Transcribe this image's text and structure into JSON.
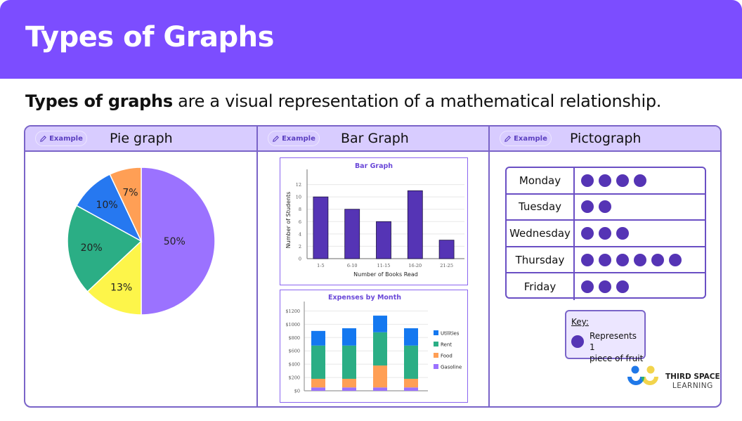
{
  "header": {
    "title": "Types of Graphs"
  },
  "intro": {
    "bold": "Types of graphs",
    "rest": " are a visual representation of a mathematical relationship."
  },
  "columns": [
    {
      "pill": "Example",
      "title": "Pie graph"
    },
    {
      "pill": "Example",
      "title": "Bar Graph"
    },
    {
      "pill": "Example",
      "title": "Pictograph"
    }
  ],
  "pictograph": {
    "rows": [
      {
        "day": "Monday",
        "count": 4
      },
      {
        "day": "Tuesday",
        "count": 2
      },
      {
        "day": "Wednesday",
        "count": 3
      },
      {
        "day": "Thursday",
        "count": 6
      },
      {
        "day": "Friday",
        "count": 3
      }
    ],
    "key_label": "Key:",
    "key_text_1": "Represents 1",
    "key_text_2": "piece of fruit",
    "dot_color": "#5534b5"
  },
  "logo": {
    "line1": "THIRD SPACE",
    "line2": "LEARNING"
  },
  "chart_data": [
    {
      "type": "pie",
      "title": "",
      "start": "top, clockwise",
      "slices": [
        {
          "label": "50%",
          "value": 50,
          "color": "#9b72ff"
        },
        {
          "label": "13%",
          "value": 13,
          "color": "#fdf54a"
        },
        {
          "label": "20%",
          "value": 20,
          "color": "#2bae85"
        },
        {
          "label": "10%",
          "value": 10,
          "color": "#2678f0"
        },
        {
          "label": "7%",
          "value": 7,
          "color": "#ff9f55"
        }
      ]
    },
    {
      "type": "bar",
      "title": "Bar Graph",
      "categories": [
        "1-5",
        "6-10",
        "11-15",
        "16-20",
        "21-25"
      ],
      "values": [
        10,
        8,
        6,
        11,
        3
      ],
      "xlabel": "Number of Books Read",
      "ylabel": "Number of Students",
      "ylim": [
        0,
        14
      ],
      "yticks": [
        0,
        2,
        4,
        6,
        8,
        10,
        12
      ],
      "grid": true,
      "bar_color": "#5534b5"
    },
    {
      "type": "bar",
      "stacked": true,
      "title": "Expenses by Month",
      "categories": [
        "",
        "",
        "",
        ""
      ],
      "series": [
        {
          "name": "Gasoline",
          "values": [
            50,
            50,
            50,
            50
          ],
          "color": "#9b72ff"
        },
        {
          "name": "Food",
          "values": [
            130,
            130,
            330,
            130
          ],
          "color": "#ff9f55"
        },
        {
          "name": "Rent",
          "values": [
            500,
            500,
            500,
            500
          ],
          "color": "#2bae85"
        },
        {
          "name": "Utilities",
          "values": [
            220,
            260,
            250,
            260
          ],
          "color": "#1478f0"
        }
      ],
      "legend_order": [
        "Utilities",
        "Rent",
        "Food",
        "Gasoline"
      ],
      "ylim": [
        0,
        1300
      ],
      "yticks": [
        "$0",
        "$200",
        "$400",
        "$600",
        "$800",
        "$1000",
        "$1200"
      ],
      "ytick_values": [
        0,
        200,
        400,
        600,
        800,
        1000,
        1200
      ],
      "legend": "right",
      "grid": true
    }
  ]
}
